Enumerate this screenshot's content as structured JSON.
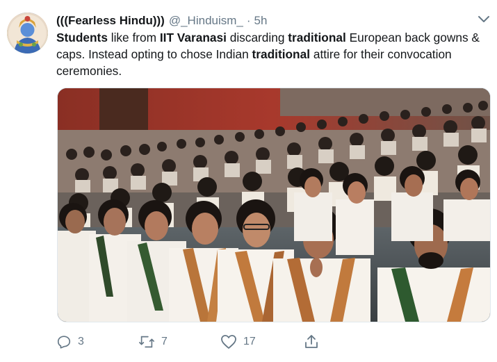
{
  "tweet": {
    "display_name": "(((Fearless Hindu)))",
    "handle": "@_Hinduism_",
    "separator": "·",
    "time": "5h",
    "text_parts": {
      "p1_bold": "Students",
      "p2": " like from ",
      "p3_bold": "IIT Varanasi",
      "p4": " discarding ",
      "p5_bold": "traditional",
      "p6": " European back gowns & caps. Instead opting to chose Indian ",
      "p7_bold": "traditional",
      "p8": " attire for their convocation ceremonies."
    },
    "image_alt": "Students in a convocation hall wearing white kurtas with traditional stoles"
  },
  "actions": {
    "reply_count": "3",
    "retweet_count": "7",
    "like_count": "17"
  },
  "icons": {
    "avatar": "avatar-image",
    "caret": "chevron-down-icon",
    "reply": "reply-icon",
    "retweet": "retweet-icon",
    "like": "heart-icon",
    "share": "share-icon"
  },
  "colors": {
    "text": "#14171a",
    "secondary": "#657786",
    "border": "#e1e8ed"
  }
}
